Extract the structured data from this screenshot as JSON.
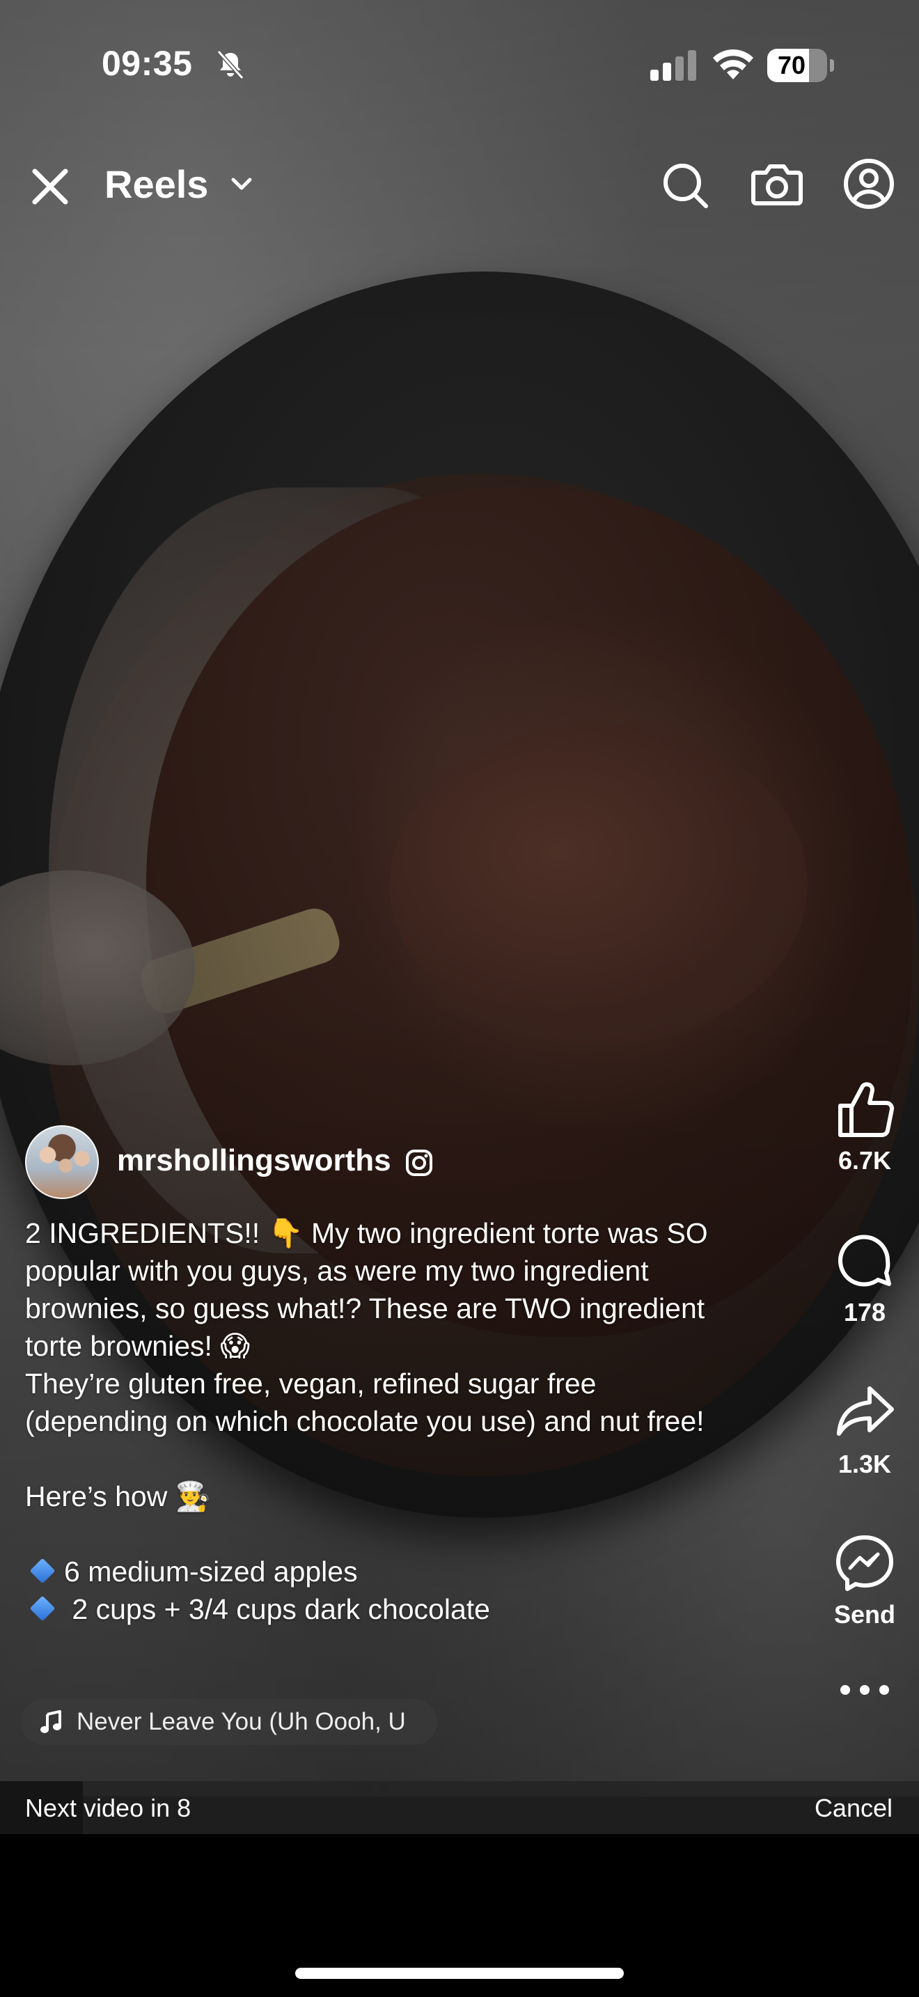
{
  "status_bar": {
    "time": "09:35",
    "battery_level": "70",
    "icons": [
      "bell-slash-icon",
      "signal-icon",
      "wifi-icon",
      "battery-icon"
    ]
  },
  "header": {
    "title": "Reels",
    "icons": [
      "close-icon",
      "chevron-down-icon",
      "search-icon",
      "camera-icon",
      "profile-icon"
    ]
  },
  "actions": {
    "like_count": "6.7K",
    "comment_count": "178",
    "share_count": "1.3K",
    "send_label": "Send"
  },
  "post": {
    "username": "mrshollingsworths",
    "caption_lines": [
      "2 INGREDIENTS!! 👇 My two ingredient torte was SO",
      "popular with you guys, as were my two ingredient",
      "brownies, so guess what!? These are TWO ingredient",
      "torte brownies! 😱",
      "They’re gluten free, vegan, refined sugar free",
      "(depending on which chocolate you use) and nut free!",
      "Here’s how 👨‍🍳",
      "6 medium-sized apples",
      " 2 cups + 3/4 cups dark chocolate"
    ]
  },
  "music": {
    "track": "Never Leave You (Uh Oooh, U"
  },
  "next_video": {
    "text": "Next video in 8",
    "cancel_label": "Cancel",
    "progress": 0.09
  },
  "colors": {
    "background": "#000000",
    "text": "#ffffff",
    "diamond": "#3a86ff"
  }
}
